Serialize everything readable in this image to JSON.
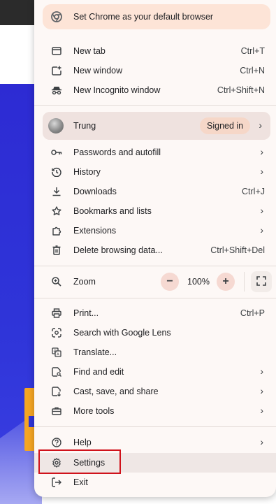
{
  "promo": {
    "label": "Set Chrome as your default browser",
    "icon": "chrome-icon"
  },
  "section1": [
    {
      "icon": "new-tab-icon",
      "label": "New tab",
      "shortcut": "Ctrl+T"
    },
    {
      "icon": "new-window-icon",
      "label": "New window",
      "shortcut": "Ctrl+N"
    },
    {
      "icon": "incognito-icon",
      "label": "New Incognito window",
      "shortcut": "Ctrl+Shift+N"
    }
  ],
  "profile": {
    "name": "Trung",
    "badge": "Signed in"
  },
  "section2": [
    {
      "icon": "key-icon",
      "label": "Passwords and autofill"
    },
    {
      "icon": "history-icon",
      "label": "History"
    },
    {
      "icon": "download-icon",
      "label": "Downloads",
      "shortcut": "Ctrl+J"
    },
    {
      "icon": "star-icon",
      "label": "Bookmarks and lists"
    },
    {
      "icon": "puzzle-icon",
      "label": "Extensions"
    },
    {
      "icon": "trash-icon",
      "label": "Delete browsing data...",
      "shortcut": "Ctrl+Shift+Del"
    }
  ],
  "zoom": {
    "label": "Zoom",
    "value": "100%",
    "minus": "−",
    "plus": "+"
  },
  "section3": [
    {
      "icon": "print-icon",
      "label": "Print...",
      "shortcut": "Ctrl+P"
    },
    {
      "icon": "lens-icon",
      "label": "Search with Google Lens"
    },
    {
      "icon": "translate-icon",
      "label": "Translate..."
    },
    {
      "icon": "find-icon",
      "label": "Find and edit"
    },
    {
      "icon": "cast-icon",
      "label": "Cast, save, and share"
    },
    {
      "icon": "toolbox-icon",
      "label": "More tools"
    }
  ],
  "section4": [
    {
      "icon": "help-icon",
      "label": "Help"
    },
    {
      "icon": "gear-icon",
      "label": "Settings"
    },
    {
      "icon": "exit-icon",
      "label": "Exit"
    }
  ]
}
